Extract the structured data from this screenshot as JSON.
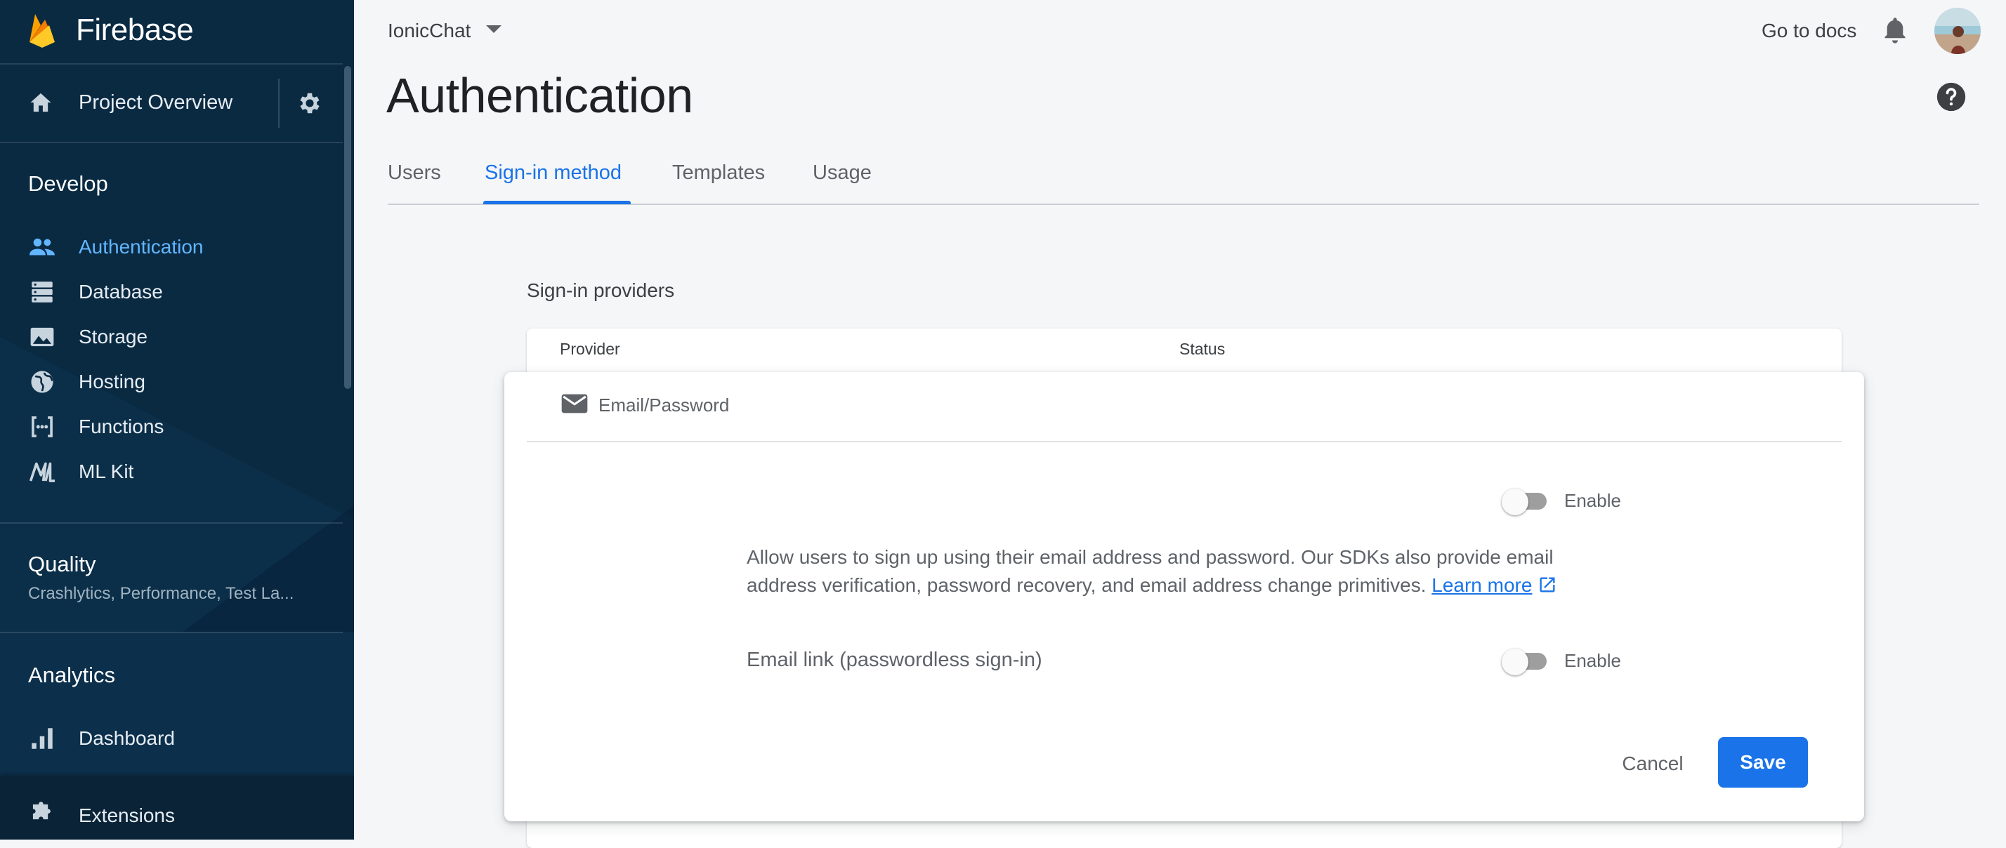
{
  "brand": {
    "name": "Firebase"
  },
  "sidebar": {
    "overview_label": "Project Overview",
    "sections": [
      {
        "title": "Develop"
      },
      {
        "title": "Quality",
        "subtitle": "Crashlytics, Performance, Test La..."
      },
      {
        "title": "Analytics"
      }
    ],
    "develop_items": [
      {
        "label": "Authentication",
        "icon": "people-icon",
        "active": true
      },
      {
        "label": "Database",
        "icon": "database-icon"
      },
      {
        "label": "Storage",
        "icon": "image-icon"
      },
      {
        "label": "Hosting",
        "icon": "globe-icon"
      },
      {
        "label": "Functions",
        "icon": "functions-icon"
      },
      {
        "label": "ML Kit",
        "icon": "mlkit-icon"
      }
    ],
    "analytics_items": [
      {
        "label": "Dashboard",
        "icon": "bar-chart-icon"
      }
    ],
    "extensions_label": "Extensions"
  },
  "header": {
    "project_name": "IonicChat",
    "docs_link": "Go to docs",
    "page_title": "Authentication"
  },
  "tabs": [
    {
      "label": "Users"
    },
    {
      "label": "Sign-in method",
      "active": true
    },
    {
      "label": "Templates"
    },
    {
      "label": "Usage"
    }
  ],
  "providers": {
    "section_title": "Sign-in providers",
    "columns": [
      "Provider",
      "Status"
    ],
    "editing": {
      "name": "Email/Password",
      "enable_label": "Enable",
      "enabled": false,
      "description": "Allow users to sign up using their email address and password. Our SDKs also provide email address verification, password recovery, and email address change primitives.",
      "learn_more": "Learn more",
      "email_link_label": "Email link (passwordless sign-in)",
      "email_link_enable_label": "Enable",
      "email_link_enabled": false,
      "cancel_label": "Cancel",
      "save_label": "Save"
    }
  },
  "colors": {
    "sidebar_bg": "#0a2a42",
    "accent": "#1a73e8",
    "active_nav": "#62b6ff",
    "page_bg": "#f5f6f8"
  }
}
